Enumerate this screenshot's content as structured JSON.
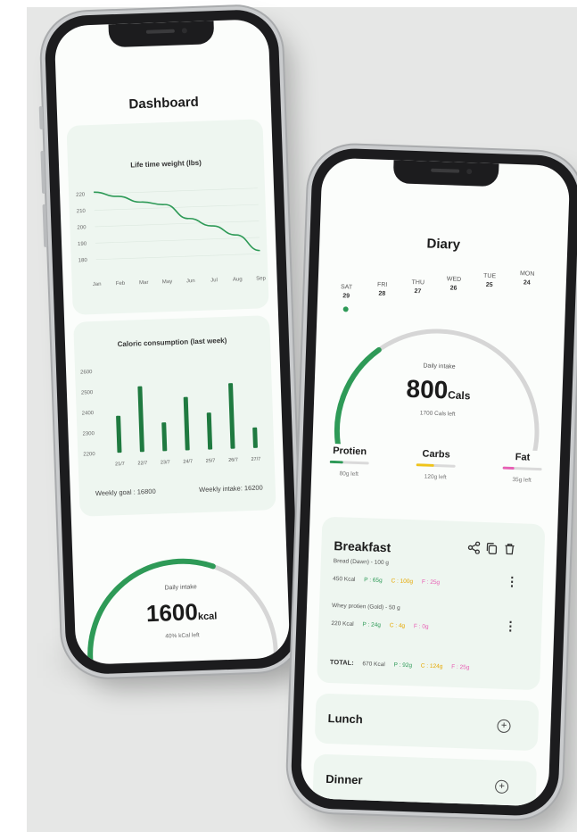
{
  "colors": {
    "accent": "#2e9a57",
    "accent_dark": "#1f7a40",
    "gauge_track": "#d6d6d6",
    "carbs": "#f0c419",
    "fat": "#e860b5"
  },
  "dashboard": {
    "title": "Dashboard",
    "weight_chart": {
      "title": "Life time weight (lbs)",
      "y_ticks": [
        "220",
        "210",
        "200",
        "190",
        "180"
      ],
      "x_ticks": [
        "Jan",
        "Feb",
        "Mar",
        "May",
        "Jun",
        "Jul",
        "Aug",
        "Sep"
      ]
    },
    "calorie_chart": {
      "title": "Caloric consumption (last week)",
      "y_ticks": [
        "2600",
        "2500",
        "2400",
        "2300",
        "2200"
      ],
      "x_ticks": [
        "21/7",
        "22/7",
        "23/7",
        "24/7",
        "25/7",
        "26/7",
        "27/7"
      ],
      "weekly_goal": "Weekly goal : 16800",
      "weekly_intake": "Weekly intake: 16200"
    },
    "gauge": {
      "label": "Daily intake",
      "value": "1600",
      "unit": "kcal",
      "sub": "40% kCal left",
      "fraction": 0.6
    }
  },
  "diary": {
    "title": "Diary",
    "days": [
      {
        "name": "SAT",
        "num": "29",
        "selected": true
      },
      {
        "name": "FRI",
        "num": "28"
      },
      {
        "name": "THU",
        "num": "27"
      },
      {
        "name": "WED",
        "num": "26"
      },
      {
        "name": "TUE",
        "num": "25"
      },
      {
        "name": "MON",
        "num": "24"
      }
    ],
    "gauge": {
      "label": "Daily intake",
      "value": "800",
      "unit": "Cals",
      "sub": "1700 Cals left",
      "fraction": 0.32
    },
    "macros": [
      {
        "name": "Protien",
        "left": "80g left",
        "color": "#2e9a57",
        "fraction": 0.35
      },
      {
        "name": "Carbs",
        "left": "120g left",
        "color": "#f0c419",
        "fraction": 0.45
      },
      {
        "name": "Fat",
        "left": "35g left",
        "color": "#e860b5",
        "fraction": 0.3
      }
    ],
    "breakfast": {
      "title": "Breakfast",
      "items": [
        {
          "name": "Bread (Dawn) - 100 g",
          "kcal": "450 Kcal",
          "p": "P : 65g",
          "c": "C : 100g",
          "f": "F : 25g"
        },
        {
          "name": "Whey protien (Gold) - 50 g",
          "kcal": "220 Kcal",
          "p": "P : 24g",
          "c": "C : 4g",
          "f": "F : 0g"
        }
      ],
      "total": {
        "label": "TOTAL:",
        "kcal": "670 Kcal",
        "p": "P : 92g",
        "c": "C : 124g",
        "f": "F : 25g"
      }
    },
    "lunch": {
      "title": "Lunch"
    },
    "dinner": {
      "title": "Dinner"
    }
  },
  "chart_data": [
    {
      "type": "line",
      "title": "Life time weight (lbs)",
      "categories": [
        "Jan",
        "Feb",
        "Mar",
        "May",
        "Jun",
        "Jul",
        "Aug",
        "Sep"
      ],
      "values": [
        221,
        218,
        214,
        212,
        203,
        198,
        192,
        182
      ],
      "ylim": [
        175,
        225
      ],
      "grid": true
    },
    {
      "type": "bar",
      "title": "Caloric consumption (last week)",
      "categories": [
        "21/7",
        "22/7",
        "23/7",
        "24/7",
        "25/7",
        "26/7",
        "27/7"
      ],
      "values": [
        2380,
        2520,
        2340,
        2460,
        2380,
        2520,
        2300
      ],
      "ylim": [
        2200,
        2600
      ]
    }
  ]
}
